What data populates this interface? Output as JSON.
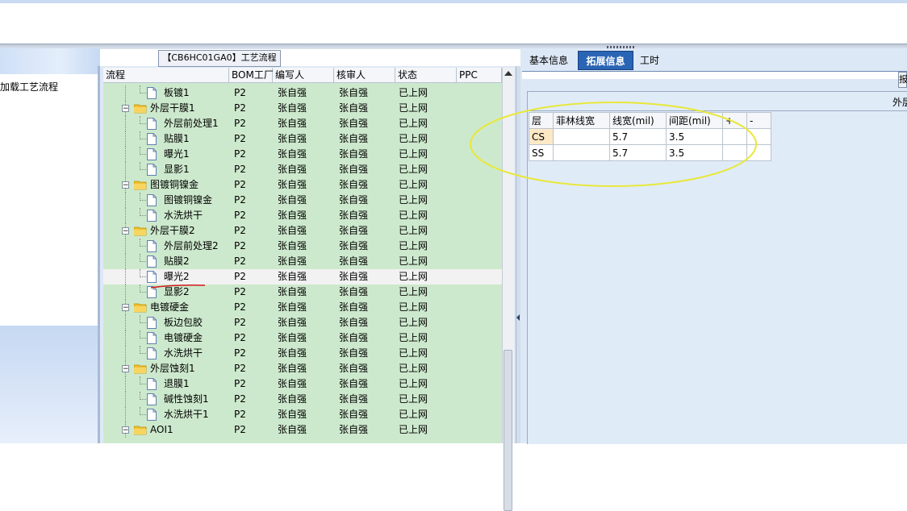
{
  "left_panel": {
    "item_label": "加载工艺流程"
  },
  "center_title": "【CB6HC01GA0】工艺流程",
  "grid": {
    "headers": [
      "流程",
      "BOM工厂",
      "编写人",
      "核审人",
      "状态",
      "PPC"
    ],
    "rows": [
      {
        "level": 2,
        "type": "doc",
        "name": "板镀1",
        "bom": "P2",
        "writer": "张自强",
        "reviewer": "张自强",
        "status": "已上网"
      },
      {
        "level": 1,
        "type": "folder",
        "name": "外层干膜1",
        "bom": "P2",
        "writer": "张自强",
        "reviewer": "张自强",
        "status": "已上网"
      },
      {
        "level": 2,
        "type": "doc",
        "name": "外层前处理1",
        "bom": "P2",
        "writer": "张自强",
        "reviewer": "张自强",
        "status": "已上网"
      },
      {
        "level": 2,
        "type": "doc",
        "name": "贴膜1",
        "bom": "P2",
        "writer": "张自强",
        "reviewer": "张自强",
        "status": "已上网"
      },
      {
        "level": 2,
        "type": "doc",
        "name": "曝光1",
        "bom": "P2",
        "writer": "张自强",
        "reviewer": "张自强",
        "status": "已上网"
      },
      {
        "level": 2,
        "type": "doc",
        "name": "显影1",
        "bom": "P2",
        "writer": "张自强",
        "reviewer": "张自强",
        "status": "已上网"
      },
      {
        "level": 1,
        "type": "folder",
        "name": "图镀铜镍金",
        "bom": "P2",
        "writer": "张自强",
        "reviewer": "张自强",
        "status": "已上网"
      },
      {
        "level": 2,
        "type": "doc",
        "name": "图镀铜镍金",
        "bom": "P2",
        "writer": "张自强",
        "reviewer": "张自强",
        "status": "已上网"
      },
      {
        "level": 2,
        "type": "doc",
        "name": "水洗烘干",
        "bom": "P2",
        "writer": "张自强",
        "reviewer": "张自强",
        "status": "已上网"
      },
      {
        "level": 1,
        "type": "folder",
        "name": "外层干膜2",
        "bom": "P2",
        "writer": "张自强",
        "reviewer": "张自强",
        "status": "已上网"
      },
      {
        "level": 2,
        "type": "doc",
        "name": "外层前处理2",
        "bom": "P2",
        "writer": "张自强",
        "reviewer": "张自强",
        "status": "已上网"
      },
      {
        "level": 2,
        "type": "doc",
        "name": "贴膜2",
        "bom": "P2",
        "writer": "张自强",
        "reviewer": "张自强",
        "status": "已上网"
      },
      {
        "level": 2,
        "type": "doc",
        "name": "曝光2",
        "bom": "P2",
        "writer": "张自强",
        "reviewer": "张自强",
        "status": "已上网",
        "selected": true
      },
      {
        "level": 2,
        "type": "doc",
        "name": "显影2",
        "bom": "P2",
        "writer": "张自强",
        "reviewer": "张自强",
        "status": "已上网"
      },
      {
        "level": 1,
        "type": "folder",
        "name": "电镀硬金",
        "bom": "P2",
        "writer": "张自强",
        "reviewer": "张自强",
        "status": "已上网"
      },
      {
        "level": 2,
        "type": "doc",
        "name": "板边包胶",
        "bom": "P2",
        "writer": "张自强",
        "reviewer": "张自强",
        "status": "已上网"
      },
      {
        "level": 2,
        "type": "doc",
        "name": "电镀硬金",
        "bom": "P2",
        "writer": "张自强",
        "reviewer": "张自强",
        "status": "已上网"
      },
      {
        "level": 2,
        "type": "doc",
        "name": "水洗烘干",
        "bom": "P2",
        "writer": "张自强",
        "reviewer": "张自强",
        "status": "已上网"
      },
      {
        "level": 1,
        "type": "folder",
        "name": "外层蚀刻1",
        "bom": "P2",
        "writer": "张自强",
        "reviewer": "张自强",
        "status": "已上网"
      },
      {
        "level": 2,
        "type": "doc",
        "name": "退膜1",
        "bom": "P2",
        "writer": "张自强",
        "reviewer": "张自强",
        "status": "已上网"
      },
      {
        "level": 2,
        "type": "doc",
        "name": "碱性蚀刻1",
        "bom": "P2",
        "writer": "张自强",
        "reviewer": "张自强",
        "status": "已上网"
      },
      {
        "level": 2,
        "type": "doc",
        "name": "水洗烘干1",
        "bom": "P2",
        "writer": "张自强",
        "reviewer": "张自强",
        "status": "已上网"
      },
      {
        "level": 1,
        "type": "folder",
        "name": "AOI1",
        "bom": "P2",
        "writer": "张自强",
        "reviewer": "张自强",
        "status": "已上网"
      }
    ]
  },
  "right_panel": {
    "tabs": [
      {
        "label": "基本信息",
        "active": false
      },
      {
        "label": "拓展信息",
        "active": true
      },
      {
        "label": "工时",
        "active": false
      }
    ],
    "section_title": "外层",
    "table": {
      "headers": [
        "层",
        "菲林线宽",
        "线宽(mil)",
        "间距(mil)",
        "+",
        "-"
      ],
      "rows": [
        [
          "CS",
          "",
          "5.7",
          "3.5",
          "",
          ""
        ],
        [
          "SS",
          "",
          "5.7",
          "3.5",
          "",
          ""
        ]
      ]
    }
  },
  "colors": {
    "grid_background": "#cde9cd",
    "active_tab": "#2a64b4",
    "annotation_ellipse": "#e8e83a",
    "annotation_underline": "#d21b1b"
  }
}
